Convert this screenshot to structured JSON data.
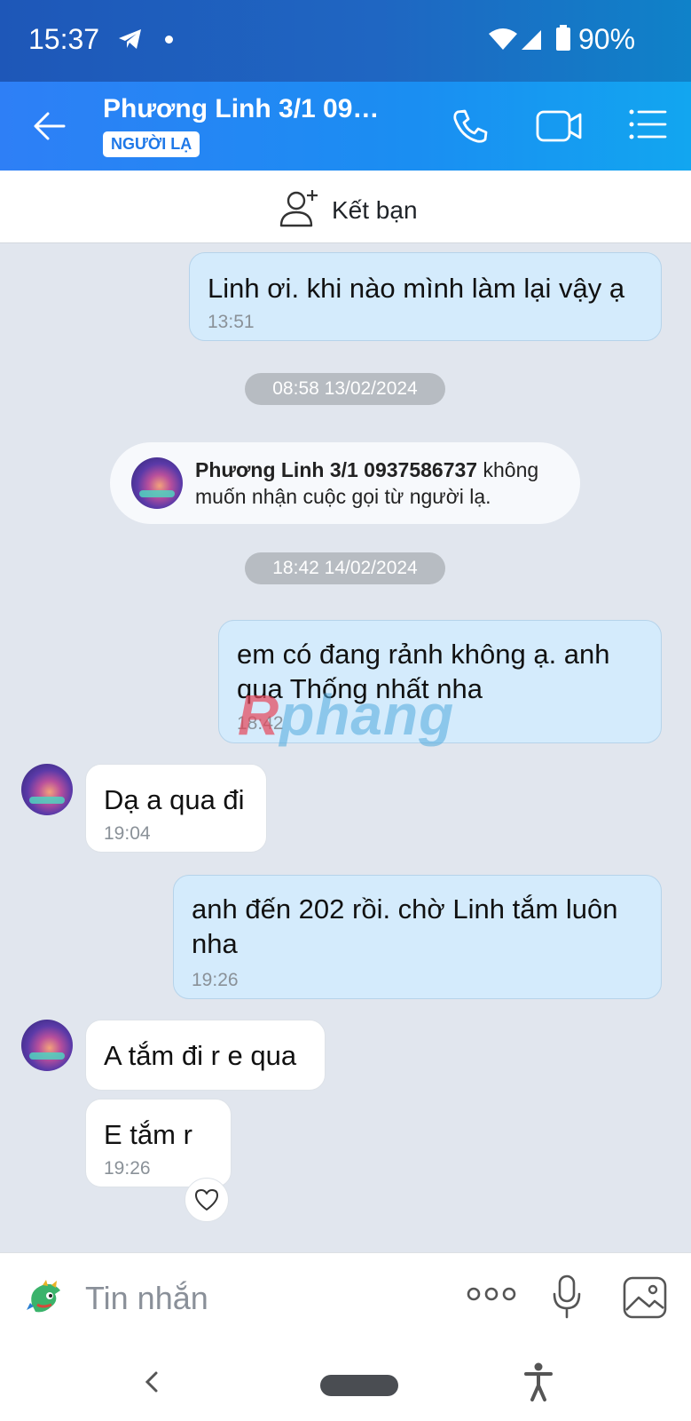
{
  "status_bar": {
    "time": "15:37",
    "battery": "90%"
  },
  "header": {
    "title": "Phương Linh 3/1 09…",
    "badge": "NGƯỜI LẠ",
    "icons": [
      "back-arrow-icon",
      "phone-icon",
      "video-icon",
      "list-icon"
    ]
  },
  "friend_bar": {
    "label": "Kết bạn"
  },
  "messages": [
    {
      "id": "m1",
      "side": "out",
      "text": "Linh ơi. khi nào mình làm lại vậy ạ",
      "time": "13:51"
    },
    {
      "id": "d1",
      "type": "date",
      "text": "08:58 13/02/2024"
    },
    {
      "id": "n1",
      "type": "notice",
      "name": "Phương Linh 3/1 0937586737",
      "text": " không muốn nhận cuộc gọi từ người lạ."
    },
    {
      "id": "d2",
      "type": "date",
      "text": "18:42 14/02/2024"
    },
    {
      "id": "m2",
      "side": "out",
      "text": "em có đang rảnh không ạ.  anh qua Thống nhất nha",
      "time": "18:42"
    },
    {
      "id": "m3",
      "side": "in",
      "text": "Dạ a qua đi",
      "time": "19:04"
    },
    {
      "id": "m4",
      "side": "out",
      "text": "anh đến 202 rồi. chờ Linh tắm luôn nha",
      "time": "19:26"
    },
    {
      "id": "m5",
      "side": "in",
      "text": "A tắm đi r e qua",
      "time": ""
    },
    {
      "id": "m6",
      "side": "in",
      "text": "E tắm r",
      "time": "19:26"
    }
  ],
  "watermark": {
    "r": "R",
    "rest": "phang"
  },
  "input_bar": {
    "placeholder": "Tin nhắn"
  },
  "colors": {
    "header": "#2e7ff6",
    "outgoing_bubble": "#d4ebfc",
    "chat_bg": "#e1e6ee"
  }
}
